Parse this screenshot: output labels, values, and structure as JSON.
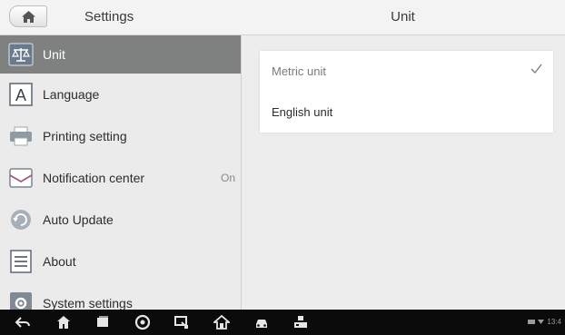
{
  "header": {
    "left_title": "Settings",
    "right_title": "Unit"
  },
  "sidebar": {
    "items": [
      {
        "label": "Unit",
        "icon": "unit-icon",
        "value": "",
        "active": true
      },
      {
        "label": "Language",
        "icon": "language-icon",
        "value": ""
      },
      {
        "label": "Printing setting",
        "icon": "printer-icon",
        "value": ""
      },
      {
        "label": "Notification center",
        "icon": "notification-icon",
        "value": "On"
      },
      {
        "label": "Auto Update",
        "icon": "auto-update-icon",
        "value": ""
      },
      {
        "label": "About",
        "icon": "about-icon",
        "value": ""
      },
      {
        "label": "System settings",
        "icon": "system-settings-icon",
        "value": ""
      }
    ]
  },
  "unit_options": [
    {
      "label": "Metric unit",
      "selected": true
    },
    {
      "label": "English unit",
      "selected": false
    }
  ],
  "navbar": {
    "icons": [
      "back-icon",
      "home-icon",
      "recent-apps-icon",
      "browser-icon",
      "screen-record-icon",
      "autel-home-icon",
      "car-icon",
      "vci-icon"
    ],
    "status_time": "13:4"
  },
  "colors": {
    "active_item": "#7f8080",
    "navbar": "#0b0b0b",
    "accent": "#3a6ea5"
  }
}
